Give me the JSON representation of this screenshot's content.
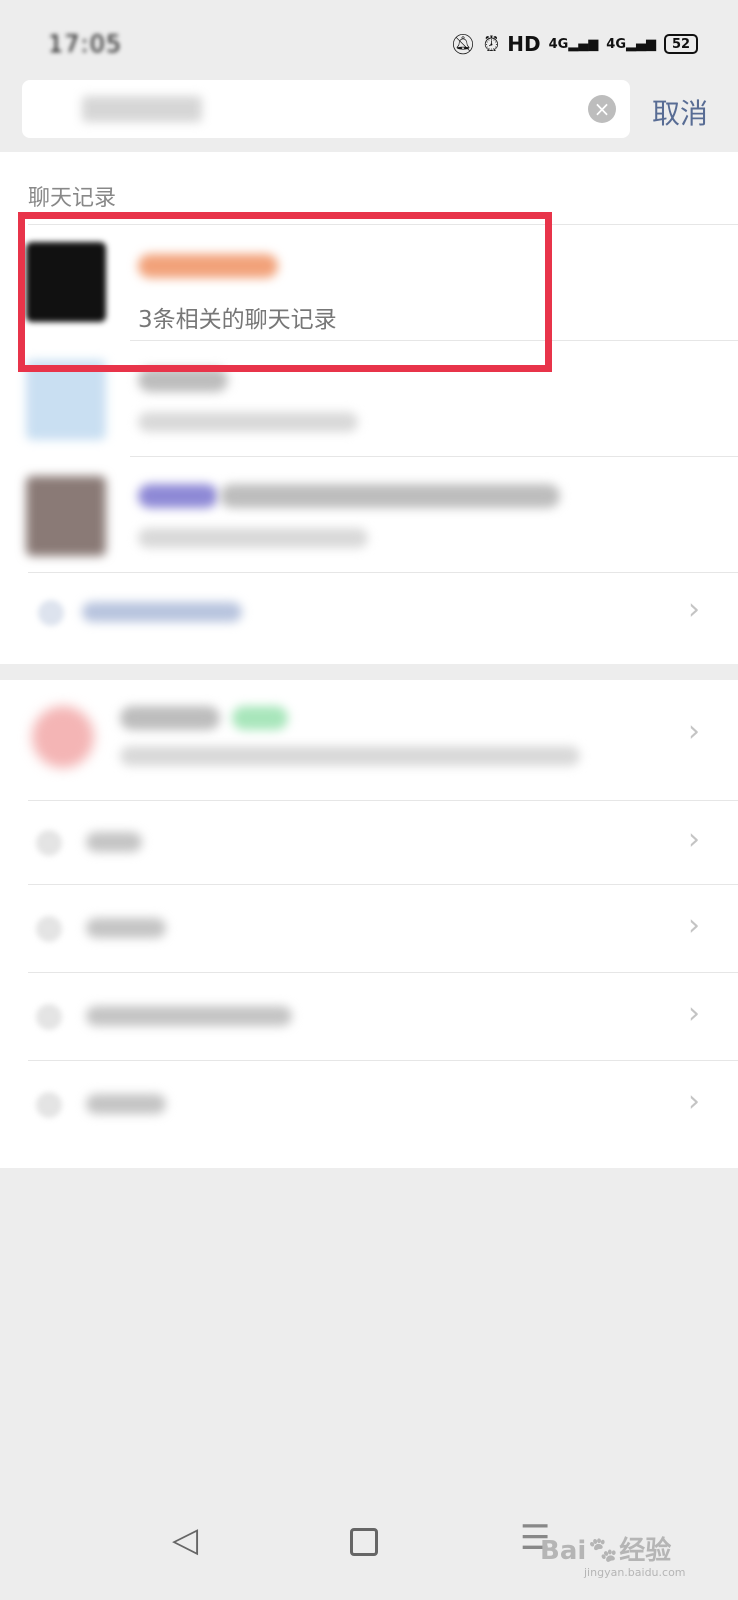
{
  "status_bar": {
    "time": "17:05",
    "hd_label": "HD",
    "signal_label_1": "4G",
    "signal_label_2": "4G",
    "battery": "52"
  },
  "search": {
    "cancel_label": "取消"
  },
  "results": {
    "section_title": "聊天记录",
    "first_result_subtitle": "3条相关的聊天记录"
  },
  "watermark": {
    "brand": "Bai",
    "brand_suffix": "经验",
    "url": "jingyan.baidu.com"
  },
  "colors": {
    "highlight": "#e8344a",
    "accent": "#586c94"
  }
}
